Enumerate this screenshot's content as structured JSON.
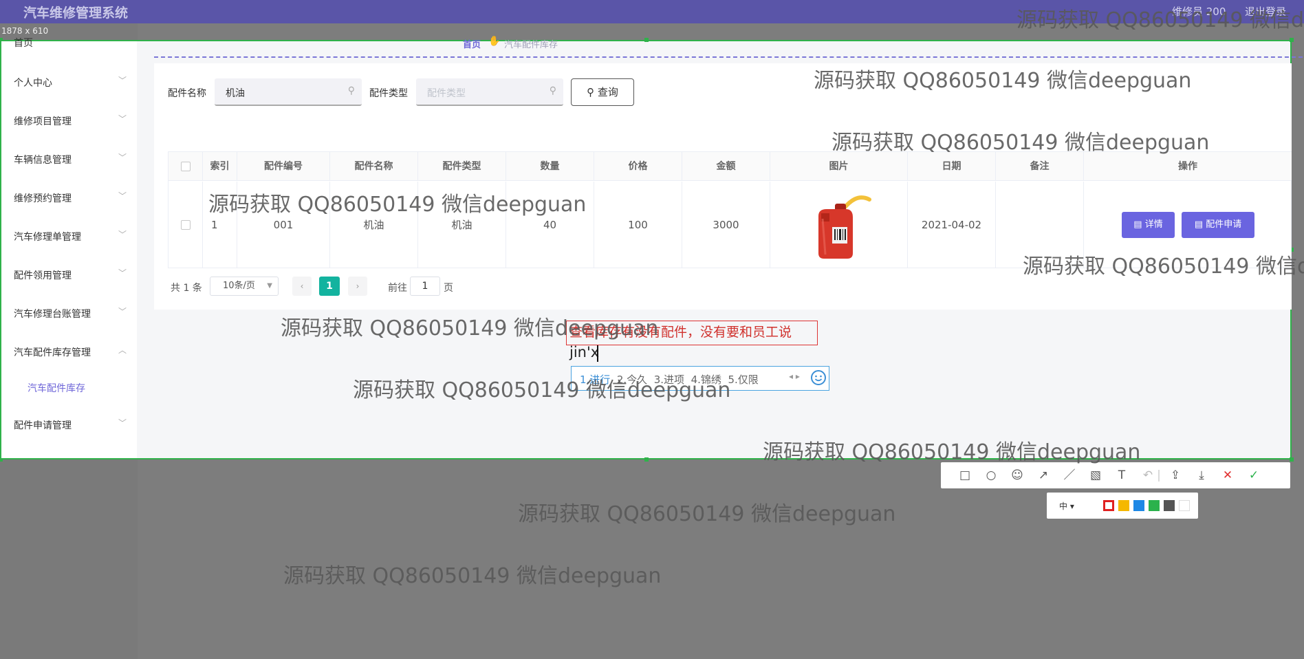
{
  "app": {
    "title": "汽车维修管理系统",
    "user": "维修员 200",
    "logout": "退出登录"
  },
  "capture": {
    "size_label": "1878 x 610"
  },
  "sidebar": {
    "home": "首页",
    "items": [
      {
        "label": "个人中心"
      },
      {
        "label": "维修项目管理"
      },
      {
        "label": "车辆信息管理"
      },
      {
        "label": "维修预约管理"
      },
      {
        "label": "汽车修理单管理"
      },
      {
        "label": "配件领用管理"
      },
      {
        "label": "汽车修理台账管理"
      },
      {
        "label": "汽车配件库存管理"
      },
      {
        "label": "配件申请管理"
      }
    ],
    "active_sub": "汽车配件库存"
  },
  "breadcrumb": {
    "home": "首页",
    "current": "汽车配件库存"
  },
  "filters": {
    "name_label": "配件名称",
    "name_value": "机油",
    "type_label": "配件类型",
    "type_placeholder": "配件类型",
    "search_label": "查询"
  },
  "table": {
    "columns": [
      "索引",
      "配件编号",
      "配件名称",
      "配件类型",
      "数量",
      "价格",
      "金额",
      "图片",
      "日期",
      "备注",
      "操作"
    ],
    "rows": [
      {
        "index": "1",
        "code": "001",
        "name": "机油",
        "type": "机油",
        "qty": "40",
        "price": "100",
        "amount": "3000",
        "date": "2021-04-02",
        "note": ""
      }
    ],
    "actions": {
      "detail": "详情",
      "apply": "配件申请"
    }
  },
  "pagination": {
    "total": "共 1 条",
    "page_size": "10条/页",
    "current": "1",
    "goto": "前往",
    "goto_value": "1",
    "page_unit": "页"
  },
  "annotation": {
    "note": "查看库存有没有配件，没有要和员工说",
    "pinyin": "jin'x"
  },
  "ime": {
    "candidates": [
      "1.进行",
      "2.今久",
      "3.进项",
      "4.锦绣",
      "5.仅限"
    ]
  },
  "color_toolbar": {
    "size": "中",
    "colors": [
      "#e02020",
      "#f5b800",
      "#1e88e5",
      "#2bb24c",
      "#555555",
      "#ffffff"
    ]
  },
  "watermark": "源码获取 QQ86050149 微信deepguan"
}
